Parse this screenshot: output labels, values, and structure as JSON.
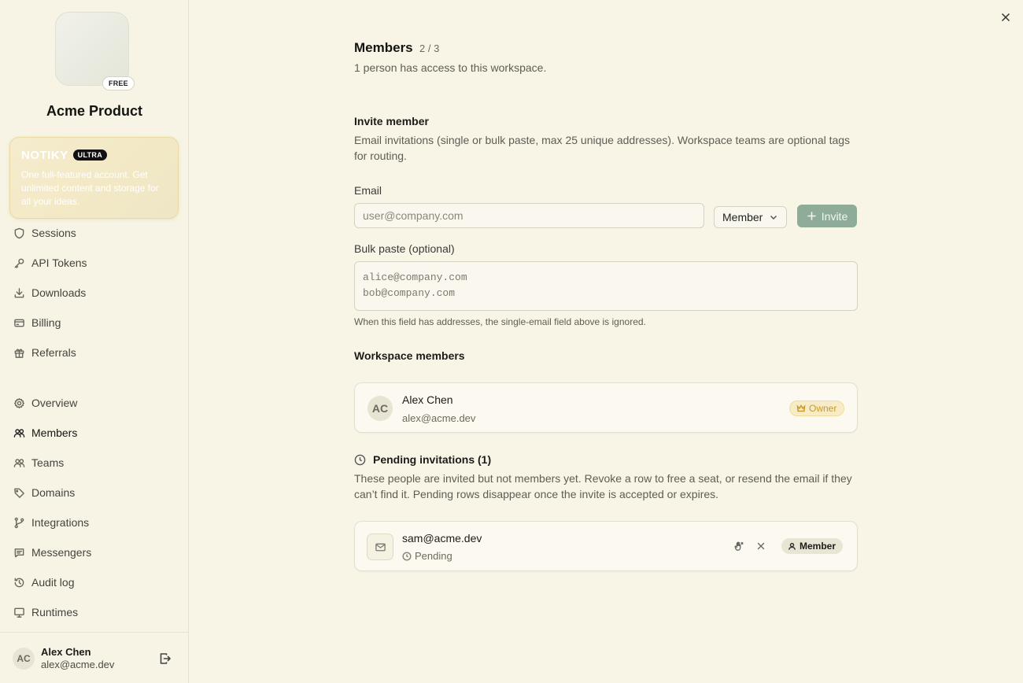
{
  "workspace": {
    "name": "Acme Product",
    "plan_badge": "FREE"
  },
  "promo": {
    "brand": "NOTIKY",
    "tier": "ULTRA",
    "text": "One full-featured account. Get unlimited content and storage for all your ideas."
  },
  "sidebar": {
    "account_items": [
      {
        "label": "Sessions",
        "icon": "shield-icon"
      },
      {
        "label": "API Tokens",
        "icon": "key-icon"
      },
      {
        "label": "Downloads",
        "icon": "download-icon"
      },
      {
        "label": "Billing",
        "icon": "credit-card-icon"
      },
      {
        "label": "Referrals",
        "icon": "gift-icon"
      }
    ],
    "workspace_items": [
      {
        "label": "Overview",
        "icon": "gear-icon"
      },
      {
        "label": "Members",
        "icon": "users-icon",
        "active": true
      },
      {
        "label": "Teams",
        "icon": "users-group-icon"
      },
      {
        "label": "Domains",
        "icon": "tag-icon"
      },
      {
        "label": "Integrations",
        "icon": "git-branch-icon"
      },
      {
        "label": "Messengers",
        "icon": "message-icon"
      },
      {
        "label": "Audit log",
        "icon": "history-icon"
      },
      {
        "label": "Runtimes",
        "icon": "monitor-icon"
      }
    ],
    "user": {
      "initials": "AC",
      "name": "Alex Chen",
      "email": "alex@acme.dev"
    }
  },
  "main": {
    "title": "Members",
    "count": "2 / 3",
    "subtitle": "1 person has access to this workspace.",
    "invite": {
      "heading": "Invite member",
      "description": "Email invitations (single or bulk paste, max 25 unique addresses). Workspace teams are optional tags for routing.",
      "email_label": "Email",
      "email_placeholder": "user@company.com",
      "role_value": "Member",
      "invite_label": "Invite",
      "bulk_label": "Bulk paste (optional)",
      "bulk_placeholder": "alice@company.com\nbob@company.com",
      "bulk_hint": "When this field has addresses, the single-email field above is ignored."
    },
    "members": {
      "heading": "Workspace members",
      "list": [
        {
          "initials": "AC",
          "name": "Alex Chen",
          "email": "alex@acme.dev",
          "role": "Owner"
        }
      ]
    },
    "pending": {
      "heading": "Pending invitations (1)",
      "description": "These people are invited but not members yet. Revoke a row to free a seat, or resend the email if they can’t find it. Pending rows disappear once the invite is accepted or expires.",
      "list": [
        {
          "email": "sam@acme.dev",
          "status": "Pending",
          "role": "Member"
        }
      ]
    }
  },
  "colors": {
    "background": "#f8f5e7",
    "accent_green": "#8fac99",
    "owner_gold": "#c89a2b"
  }
}
